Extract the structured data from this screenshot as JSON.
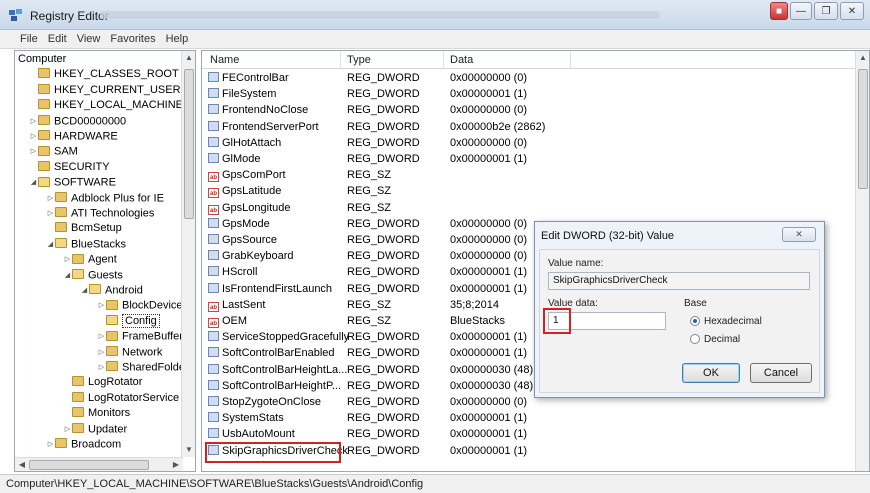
{
  "window": {
    "title": "Registry Editor"
  },
  "menu": [
    "File",
    "Edit",
    "View",
    "Favorites",
    "Help"
  ],
  "tree": [
    {
      "label": "Computer",
      "level": 0,
      "twisty": "",
      "folder": false
    },
    {
      "label": "HKEY_CLASSES_ROOT",
      "level": 1,
      "twisty": "",
      "folder": true
    },
    {
      "label": "HKEY_CURRENT_USER",
      "level": 1,
      "twisty": "",
      "folder": true
    },
    {
      "label": "HKEY_LOCAL_MACHINE",
      "level": 1,
      "twisty": "",
      "folder": true
    },
    {
      "label": "BCD00000000",
      "level": 1,
      "twisty": "▷",
      "folder": true
    },
    {
      "label": "HARDWARE",
      "level": 1,
      "twisty": "▷",
      "folder": true
    },
    {
      "label": "SAM",
      "level": 1,
      "twisty": "▷",
      "folder": true
    },
    {
      "label": "SECURITY",
      "level": 1,
      "twisty": "",
      "folder": true
    },
    {
      "label": "SOFTWARE",
      "level": 1,
      "twisty": "◢",
      "folder": true,
      "open": true
    },
    {
      "label": "Adblock Plus for IE",
      "level": 2,
      "twisty": "▷",
      "folder": true
    },
    {
      "label": "ATI Technologies",
      "level": 2,
      "twisty": "▷",
      "folder": true
    },
    {
      "label": "BcmSetup",
      "level": 2,
      "twisty": "",
      "folder": true
    },
    {
      "label": "BlueStacks",
      "level": 2,
      "twisty": "◢",
      "folder": true,
      "open": true
    },
    {
      "label": "Agent",
      "level": 3,
      "twisty": "▷",
      "folder": true
    },
    {
      "label": "Guests",
      "level": 3,
      "twisty": "◢",
      "folder": true,
      "open": true
    },
    {
      "label": "Android",
      "level": 4,
      "twisty": "◢",
      "folder": true,
      "open": true
    },
    {
      "label": "BlockDevice",
      "level": 5,
      "twisty": "▷",
      "folder": true
    },
    {
      "label": "Config",
      "level": 5,
      "twisty": "",
      "folder": true,
      "open": true,
      "selected": true
    },
    {
      "label": "FrameBuffer",
      "level": 5,
      "twisty": "▷",
      "folder": true
    },
    {
      "label": "Network",
      "level": 5,
      "twisty": "▷",
      "folder": true
    },
    {
      "label": "SharedFolder",
      "level": 5,
      "twisty": "▷",
      "folder": true
    },
    {
      "label": "LogRotator",
      "level": 3,
      "twisty": "",
      "folder": true
    },
    {
      "label": "LogRotatorService",
      "level": 3,
      "twisty": "",
      "folder": true
    },
    {
      "label": "Monitors",
      "level": 3,
      "twisty": "",
      "folder": true
    },
    {
      "label": "Updater",
      "level": 3,
      "twisty": "▷",
      "folder": true
    },
    {
      "label": "Broadcom",
      "level": 2,
      "twisty": "▷",
      "folder": true
    }
  ],
  "columns": {
    "name": "Name",
    "type": "Type",
    "data": "Data"
  },
  "values": [
    {
      "name": "FEControlBar",
      "type": "REG_DWORD",
      "data": "0x00000000 (0)"
    },
    {
      "name": "FileSystem",
      "type": "REG_DWORD",
      "data": "0x00000001 (1)"
    },
    {
      "name": "FrontendNoClose",
      "type": "REG_DWORD",
      "data": "0x00000000 (0)"
    },
    {
      "name": "FrontendServerPort",
      "type": "REG_DWORD",
      "data": "0x00000b2e (2862)"
    },
    {
      "name": "GlHotAttach",
      "type": "REG_DWORD",
      "data": "0x00000000 (0)"
    },
    {
      "name": "GlMode",
      "type": "REG_DWORD",
      "data": "0x00000001 (1)"
    },
    {
      "name": "GpsComPort",
      "type": "REG_SZ",
      "data": ""
    },
    {
      "name": "GpsLatitude",
      "type": "REG_SZ",
      "data": ""
    },
    {
      "name": "GpsLongitude",
      "type": "REG_SZ",
      "data": ""
    },
    {
      "name": "GpsMode",
      "type": "REG_DWORD",
      "data": "0x00000000 (0)"
    },
    {
      "name": "GpsSource",
      "type": "REG_DWORD",
      "data": "0x00000000 (0)"
    },
    {
      "name": "GrabKeyboard",
      "type": "REG_DWORD",
      "data": "0x00000000 (0)"
    },
    {
      "name": "HScroll",
      "type": "REG_DWORD",
      "data": "0x00000001 (1)"
    },
    {
      "name": "IsFrontendFirstLaunch",
      "type": "REG_DWORD",
      "data": "0x00000001 (1)"
    },
    {
      "name": "LastSent",
      "type": "REG_SZ",
      "data": "35;8;2014"
    },
    {
      "name": "OEM",
      "type": "REG_SZ",
      "data": "BlueStacks"
    },
    {
      "name": "ServiceStoppedGracefully",
      "type": "REG_DWORD",
      "data": "0x00000001 (1)"
    },
    {
      "name": "SoftControlBarEnabled",
      "type": "REG_DWORD",
      "data": "0x00000001 (1)"
    },
    {
      "name": "SoftControlBarHeightLa...",
      "type": "REG_DWORD",
      "data": "0x00000030 (48)"
    },
    {
      "name": "SoftControlBarHeightP...",
      "type": "REG_DWORD",
      "data": "0x00000030 (48)"
    },
    {
      "name": "StopZygoteOnClose",
      "type": "REG_DWORD",
      "data": "0x00000000 (0)"
    },
    {
      "name": "SystemStats",
      "type": "REG_DWORD",
      "data": "0x00000001 (1)"
    },
    {
      "name": "UsbAutoMount",
      "type": "REG_DWORD",
      "data": "0x00000001 (1)"
    },
    {
      "name": "SkipGraphicsDriverCheck",
      "type": "REG_DWORD",
      "data": "0x00000001 (1)"
    }
  ],
  "status": {
    "path": "Computer\\HKEY_LOCAL_MACHINE\\SOFTWARE\\BlueStacks\\Guests\\Android\\Config"
  },
  "dialog": {
    "title": "Edit DWORD (32-bit) Value",
    "value_name_label": "Value name:",
    "value_name": "SkipGraphicsDriverCheck",
    "value_data_label": "Value data:",
    "value_data": "1",
    "base_label": "Base",
    "hex_label": "Hexadecimal",
    "dec_label": "Decimal",
    "base_selected": "Hexadecimal",
    "ok_label": "OK",
    "cancel_label": "Cancel"
  },
  "colors": {
    "highlight": "#d02424",
    "accent": "#2d5fa8"
  }
}
